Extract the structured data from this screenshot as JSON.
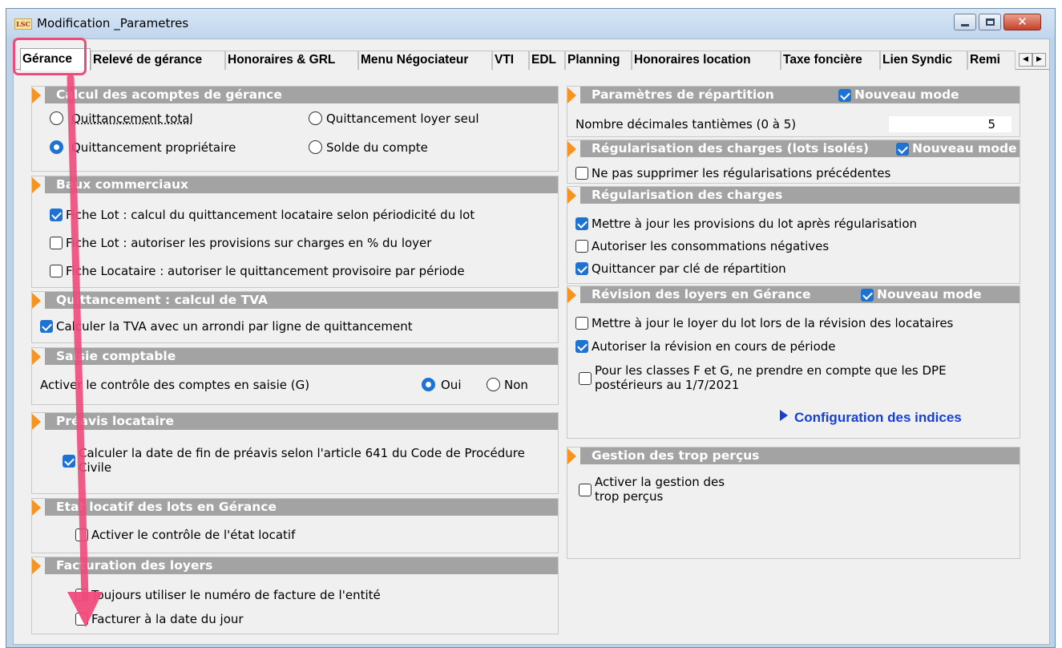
{
  "window": {
    "app_icon_text": "LSC",
    "title": "Modification _Parametres",
    "close_glyph": "✕"
  },
  "tabs": [
    "Gérance",
    "Relevé de gérance",
    "Honoraires & GRL",
    "Menu Négociateur",
    "VTI",
    "EDL",
    "Planning",
    "Honoraires location",
    "Taxe foncière",
    "Lien Syndic",
    "Remi"
  ],
  "tab_scroll": {
    "left": "◀",
    "right": "▶"
  },
  "left": {
    "acomptes": {
      "title": "Calcul des acomptes de gérance",
      "options": [
        "Quittancement total",
        "Quittancement loyer seul",
        "Quittancement propriétaire",
        "Solde du compte"
      ],
      "selected": "Quittancement propriétaire"
    },
    "baux": {
      "title": "Baux commerciaux",
      "items": [
        {
          "label": "Fiche Lot : calcul du quittancement locataire selon périodicité du lot",
          "checked": true
        },
        {
          "label": "Fiche Lot : autoriser les provisions sur charges en % du loyer",
          "checked": false
        },
        {
          "label": "Fiche Locataire : autoriser le quittancement provisoire par période",
          "checked": false
        }
      ]
    },
    "tva": {
      "title": "Quittancement : calcul de TVA",
      "item": {
        "label": "Calculer la TVA avec un arrondi par ligne de quittancement",
        "checked": true
      }
    },
    "saisie": {
      "title": "Saisie comptable",
      "label": "Activer le contrôle des comptes en saisie (G)",
      "oui": "Oui",
      "non": "Non",
      "selected": "Oui"
    },
    "preavis": {
      "title": "Préavis locataire",
      "line1": "Calculer la date de fin de préavis selon l'article 641 du Code de Procédure",
      "line2": "Civile",
      "checked": true
    },
    "etat": {
      "title": "Etat locatif des lots en Gérance",
      "item": {
        "label": "Activer le contrôle de l'état locatif",
        "checked": false
      }
    },
    "facturation": {
      "title": "Facturation des loyers",
      "items": [
        {
          "label": "Toujours utiliser le numéro de facture de l'entité",
          "checked": false
        },
        {
          "label": "Facturer à la date du jour",
          "checked": false
        }
      ]
    }
  },
  "right": {
    "repartition": {
      "title": "Paramètres de répartition",
      "nouveau_mode": "Nouveau mode",
      "nouveau_checked": true,
      "decimales_label": "Nombre décimales tantièmes (0 à 5)",
      "decimales_value": "5"
    },
    "regul_isoles": {
      "title": "Régularisation des charges (lots isolés)",
      "nouveau_mode": "Nouveau mode",
      "nouveau_checked": true,
      "item": {
        "label": "Ne pas supprimer les régularisations précédentes",
        "checked": false
      }
    },
    "regul": {
      "title": "Régularisation des charges",
      "items": [
        {
          "label": "Mettre à jour les provisions du lot après régularisation",
          "checked": true
        },
        {
          "label": "Autoriser les consommations négatives",
          "checked": false
        },
        {
          "label": "Quittancer par clé de répartition",
          "checked": true
        }
      ]
    },
    "revision": {
      "title": "Révision des loyers en Gérance",
      "nouveau_mode": "Nouveau mode",
      "nouveau_checked": true,
      "items": [
        {
          "label": "Mettre à jour le loyer du lot lors de la révision des locataires",
          "checked": false
        },
        {
          "label": "Autoriser la révision en cours de période",
          "checked": true
        }
      ],
      "dpe_line1": "Pour les classes F et G, ne prendre en compte que les DPE",
      "dpe_line2": "postérieurs au 1/7/2021",
      "dpe_checked": false,
      "config_link": "Configuration des indices"
    },
    "trop_percus": {
      "title": "Gestion des trop perçus",
      "line1": "Activer la gestion des",
      "line2": "trop perçus",
      "checked": false
    }
  },
  "colors": {
    "header_bg": "#a3a3a3",
    "header_triangle": "#f7931e",
    "checkbox_on": "#1e73d2",
    "link": "#1540d8",
    "annotation": "#f04a7c"
  }
}
